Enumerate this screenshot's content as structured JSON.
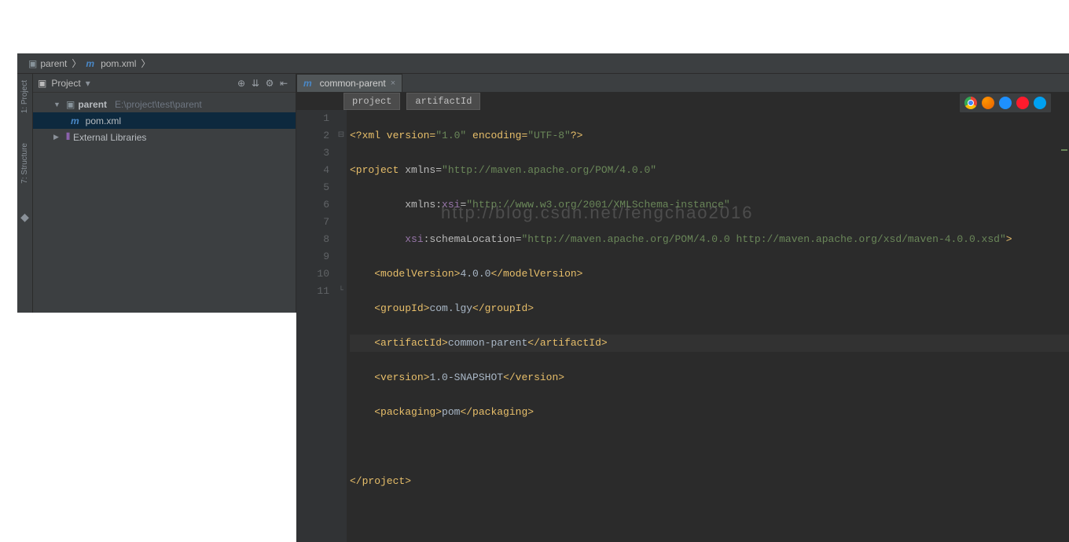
{
  "breadcrumbs": {
    "root": "parent",
    "file": "pom.xml"
  },
  "project_panel": {
    "title": "Project",
    "root_name": "parent",
    "root_path": "E:\\project\\test\\parent",
    "file": "pom.xml",
    "ext_lib": "External Libraries"
  },
  "left_tabs": {
    "project": "1: Project",
    "structure": "7: Structure"
  },
  "editor": {
    "tab_label": "common-parent",
    "path_crumbs": [
      "project",
      "artifactId"
    ],
    "watermark": "http://blog.csdn.net/fengchao2016",
    "line_numbers": [
      "1",
      "2",
      "3",
      "4",
      "5",
      "6",
      "7",
      "8",
      "9",
      "10",
      "11"
    ],
    "code": {
      "l1_pi": "<?xml version=",
      "l1_v": "\"1.0\"",
      "l1_enc": " encoding=",
      "l1_encv": "\"UTF-8\"",
      "l1_end": "?>",
      "l2_open": "<project ",
      "l2_attr": "xmlns=",
      "l2_val": "\"http://maven.apache.org/POM/4.0.0\"",
      "l3_attr": "xmlns:",
      "l3_ns": "xsi",
      "l3_eq": "=",
      "l3_val": "\"http://www.w3.org/2001/XMLSchema-instance\"",
      "l4_ns": "xsi",
      "l4_attr": ":schemaLocation=",
      "l4_val": "\"http://maven.apache.org/POM/4.0.0 http://maven.apache.org/xsd/maven-4.0.0.xsd\"",
      "l4_end": ">",
      "l5_o": "<modelVersion>",
      "l5_t": "4.0.0",
      "l5_c": "</modelVersion>",
      "l6_o": "<groupId>",
      "l6_t": "com.lgy",
      "l6_c": "</groupId>",
      "l7_o": "<artifactId>",
      "l7_t": "common-parent",
      "l7_c": "</artifactId>",
      "l8_o": "<version>",
      "l8_t": "1.0-SNAPSHOT",
      "l8_c": "</version>",
      "l9_o": "<packaging>",
      "l9_t": "pom",
      "l9_c": "</packaging>",
      "l11": "</project>"
    }
  }
}
